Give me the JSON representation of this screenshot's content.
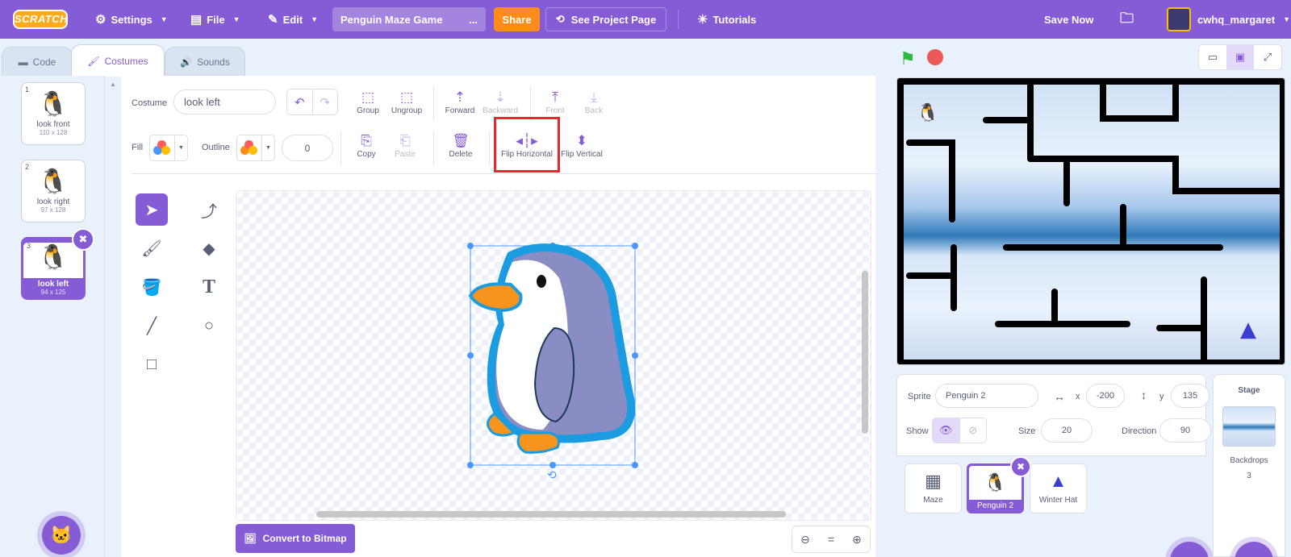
{
  "menubar": {
    "logo": "SCRATCH",
    "settings": "Settings",
    "file": "File",
    "edit": "Edit",
    "project_title": "Penguin Maze Game",
    "title_ellipsis": "...",
    "share": "Share",
    "see_project_page": "See Project Page",
    "tutorials": "Tutorials",
    "save_now": "Save Now",
    "username": "cwhq_margaret"
  },
  "tabs": [
    {
      "label": "Code",
      "icon": "code-icon"
    },
    {
      "label": "Costumes",
      "icon": "brush-icon"
    },
    {
      "label": "Sounds",
      "icon": "speaker-icon"
    }
  ],
  "costumes": [
    {
      "num": "1",
      "name": "look front",
      "size": "110 x 128"
    },
    {
      "num": "2",
      "name": "look right",
      "size": "97 x 128"
    },
    {
      "num": "3",
      "name": "look left",
      "size": "94 x 125"
    }
  ],
  "paint_toolbar": {
    "costume_label": "Costume",
    "costume_name": "look left",
    "group": "Group",
    "ungroup": "Ungroup",
    "forward": "Forward",
    "backward": "Backward",
    "front": "Front",
    "back": "Back",
    "fill_label": "Fill",
    "outline_label": "Outline",
    "outline_width": "0",
    "copy": "Copy",
    "paste": "Paste",
    "delete": "Delete",
    "flip_horizontal": "Flip Horizontal",
    "flip_vertical": "Flip Vertical"
  },
  "canvas": {
    "convert_button": "Convert to Bitmap",
    "zoom_reset": "="
  },
  "sprite_info": {
    "sprite_label": "Sprite",
    "sprite_name": "Penguin 2",
    "x_label": "x",
    "x_value": "-200",
    "y_label": "y",
    "y_value": "135",
    "show_label": "Show",
    "size_label": "Size",
    "size_value": "20",
    "direction_label": "Direction",
    "direction_value": "90"
  },
  "sprites": [
    {
      "name": "Maze"
    },
    {
      "name": "Penguin 2"
    },
    {
      "name": "Winter Hat"
    }
  ],
  "stage_pane": {
    "title": "Stage",
    "backdrops_label": "Backdrops",
    "backdrops_count": "3"
  },
  "colors": {
    "accent": "#855cd6",
    "share": "#ff8c1a",
    "highlight": "#e8262f",
    "penguin_outline": "#1b9be0",
    "penguin_body": "#8a8cc4",
    "beak": "#f7941d"
  }
}
